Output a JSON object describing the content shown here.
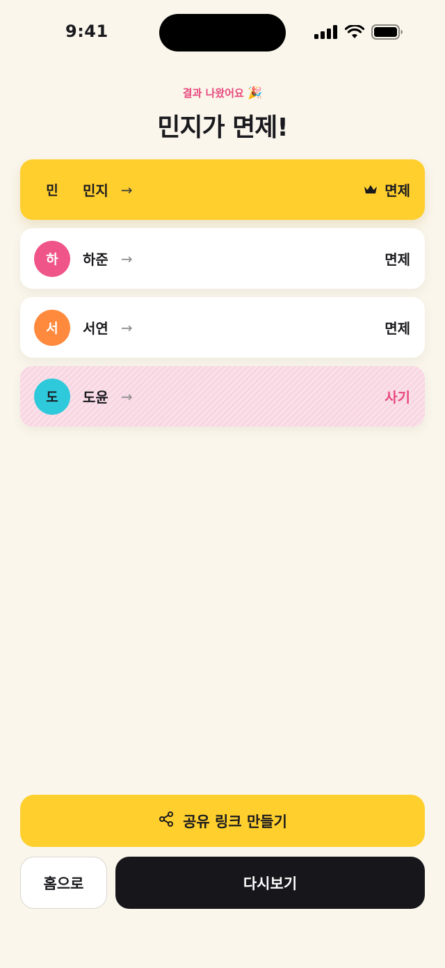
{
  "status_bar": {
    "time": "9:41"
  },
  "header": {
    "subtitle": "결과 나왔어요",
    "subtitle_emoji": "🎉",
    "title": "민지가 면제!"
  },
  "results": [
    {
      "initial": "민",
      "name": "민지",
      "arrow": "→",
      "verdict": "면제",
      "crown": true,
      "avatar_color": "#ffcf2e",
      "row_style": "winner"
    },
    {
      "initial": "하",
      "name": "하준",
      "arrow": "→",
      "verdict": "면제",
      "crown": false,
      "avatar_color": "#f0558a",
      "row_style": "normal"
    },
    {
      "initial": "서",
      "name": "서연",
      "arrow": "→",
      "verdict": "면제",
      "crown": false,
      "avatar_color": "#ff8a3d",
      "row_style": "normal"
    },
    {
      "initial": "도",
      "name": "도윤",
      "arrow": "→",
      "verdict": "사기",
      "crown": false,
      "avatar_color": "#2ec9db",
      "row_style": "liar"
    }
  ],
  "actions": {
    "share_label": "공유 링크 만들기",
    "share_icon": "share-icon",
    "home_label": "홈으로",
    "replay_label": "다시보기"
  },
  "colors": {
    "background": "#faf6ec",
    "accent_yellow": "#ffcf2e",
    "accent_pink": "#e8497e",
    "dark_button": "#17171b"
  }
}
